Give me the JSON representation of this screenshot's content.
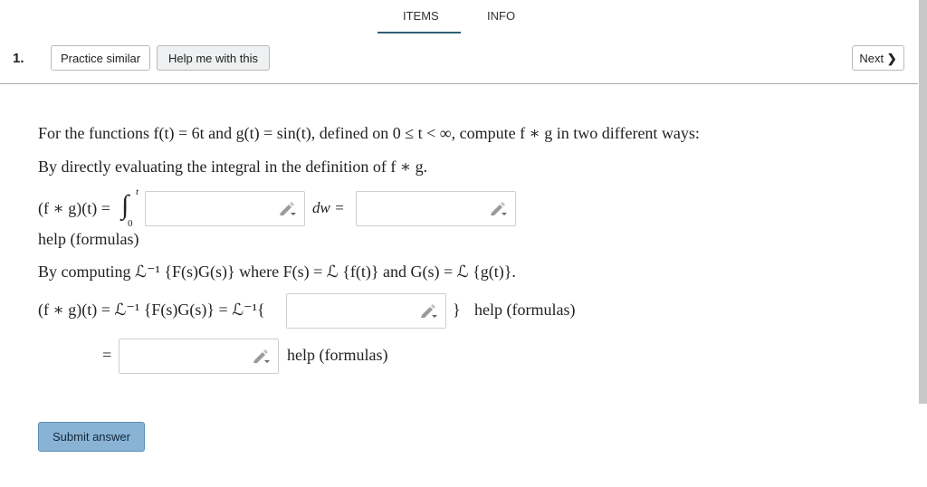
{
  "tabs": {
    "items": "ITEMS",
    "info": "INFO"
  },
  "question_number": "1.",
  "buttons": {
    "practice": "Practice similar",
    "help": "Help me with this",
    "next": "Next",
    "next_chevron": "❯",
    "submit": "Submit answer"
  },
  "problem": {
    "intro": "For the functions f(t) = 6t and g(t) = sin(t), defined on 0 ≤ t < ∞, compute f ∗ g in two different ways:",
    "part1": "By directly evaluating the integral in the definition of f ∗ g.",
    "line1_lhs": "(f ∗ g)(t) =",
    "integral": "∫",
    "upper": "t",
    "lower": "0",
    "dw": "dw  =",
    "help1": "help (formulas)",
    "part2": "By computing ℒ⁻¹ {F(s)G(s)} where F(s) = ℒ {f(t)} and G(s) = ℒ {g(t)}.",
    "line2_lhs": "(f ∗ g)(t) = ℒ⁻¹ {F(s)G(s)} = ℒ⁻¹{",
    "close_brace": "}",
    "help2": "help (formulas)",
    "equals": "=",
    "help3": "help (formulas)"
  },
  "icons": {
    "pencil": "pencil-icon"
  },
  "colors": {
    "accent": "#2e5f73",
    "submit_bg": "#89b3d5"
  }
}
